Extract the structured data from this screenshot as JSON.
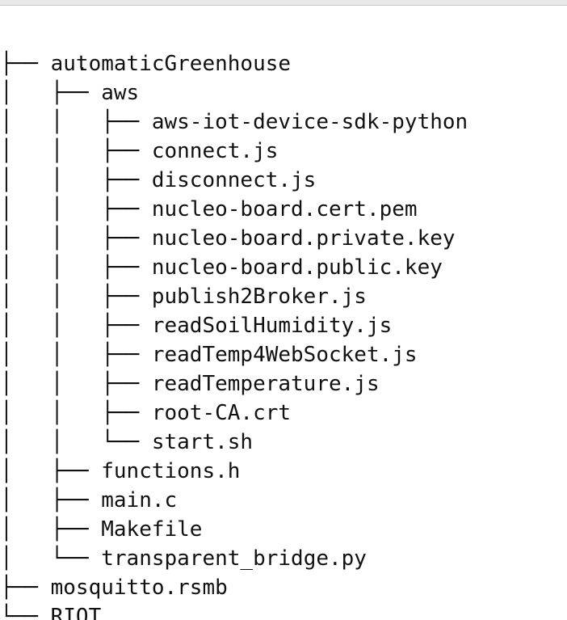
{
  "tree": {
    "root": ".",
    "lines": [
      {
        "prefix": "├── ",
        "label": "automaticGreenhouse"
      },
      {
        "prefix": "│   ├── ",
        "label": "aws"
      },
      {
        "prefix": "│   │   ├── ",
        "label": "aws-iot-device-sdk-python"
      },
      {
        "prefix": "│   │   ├── ",
        "label": "connect.js"
      },
      {
        "prefix": "│   │   ├── ",
        "label": "disconnect.js"
      },
      {
        "prefix": "│   │   ├── ",
        "label": "nucleo-board.cert.pem"
      },
      {
        "prefix": "│   │   ├── ",
        "label": "nucleo-board.private.key"
      },
      {
        "prefix": "│   │   ├── ",
        "label": "nucleo-board.public.key"
      },
      {
        "prefix": "│   │   ├── ",
        "label": "publish2Broker.js"
      },
      {
        "prefix": "│   │   ├── ",
        "label": "readSoilHumidity.js"
      },
      {
        "prefix": "│   │   ├── ",
        "label": "readTemp4WebSocket.js"
      },
      {
        "prefix": "│   │   ├── ",
        "label": "readTemperature.js"
      },
      {
        "prefix": "│   │   ├── ",
        "label": "root-CA.crt"
      },
      {
        "prefix": "│   │   └── ",
        "label": "start.sh"
      },
      {
        "prefix": "│   ├── ",
        "label": "functions.h"
      },
      {
        "prefix": "│   ├── ",
        "label": "main.c"
      },
      {
        "prefix": "│   ├── ",
        "label": "Makefile"
      },
      {
        "prefix": "│   └── ",
        "label": "transparent_bridge.py"
      },
      {
        "prefix": "├── ",
        "label": "mosquitto.rsmb"
      },
      {
        "prefix": "└── ",
        "label": "RIOT"
      }
    ]
  }
}
